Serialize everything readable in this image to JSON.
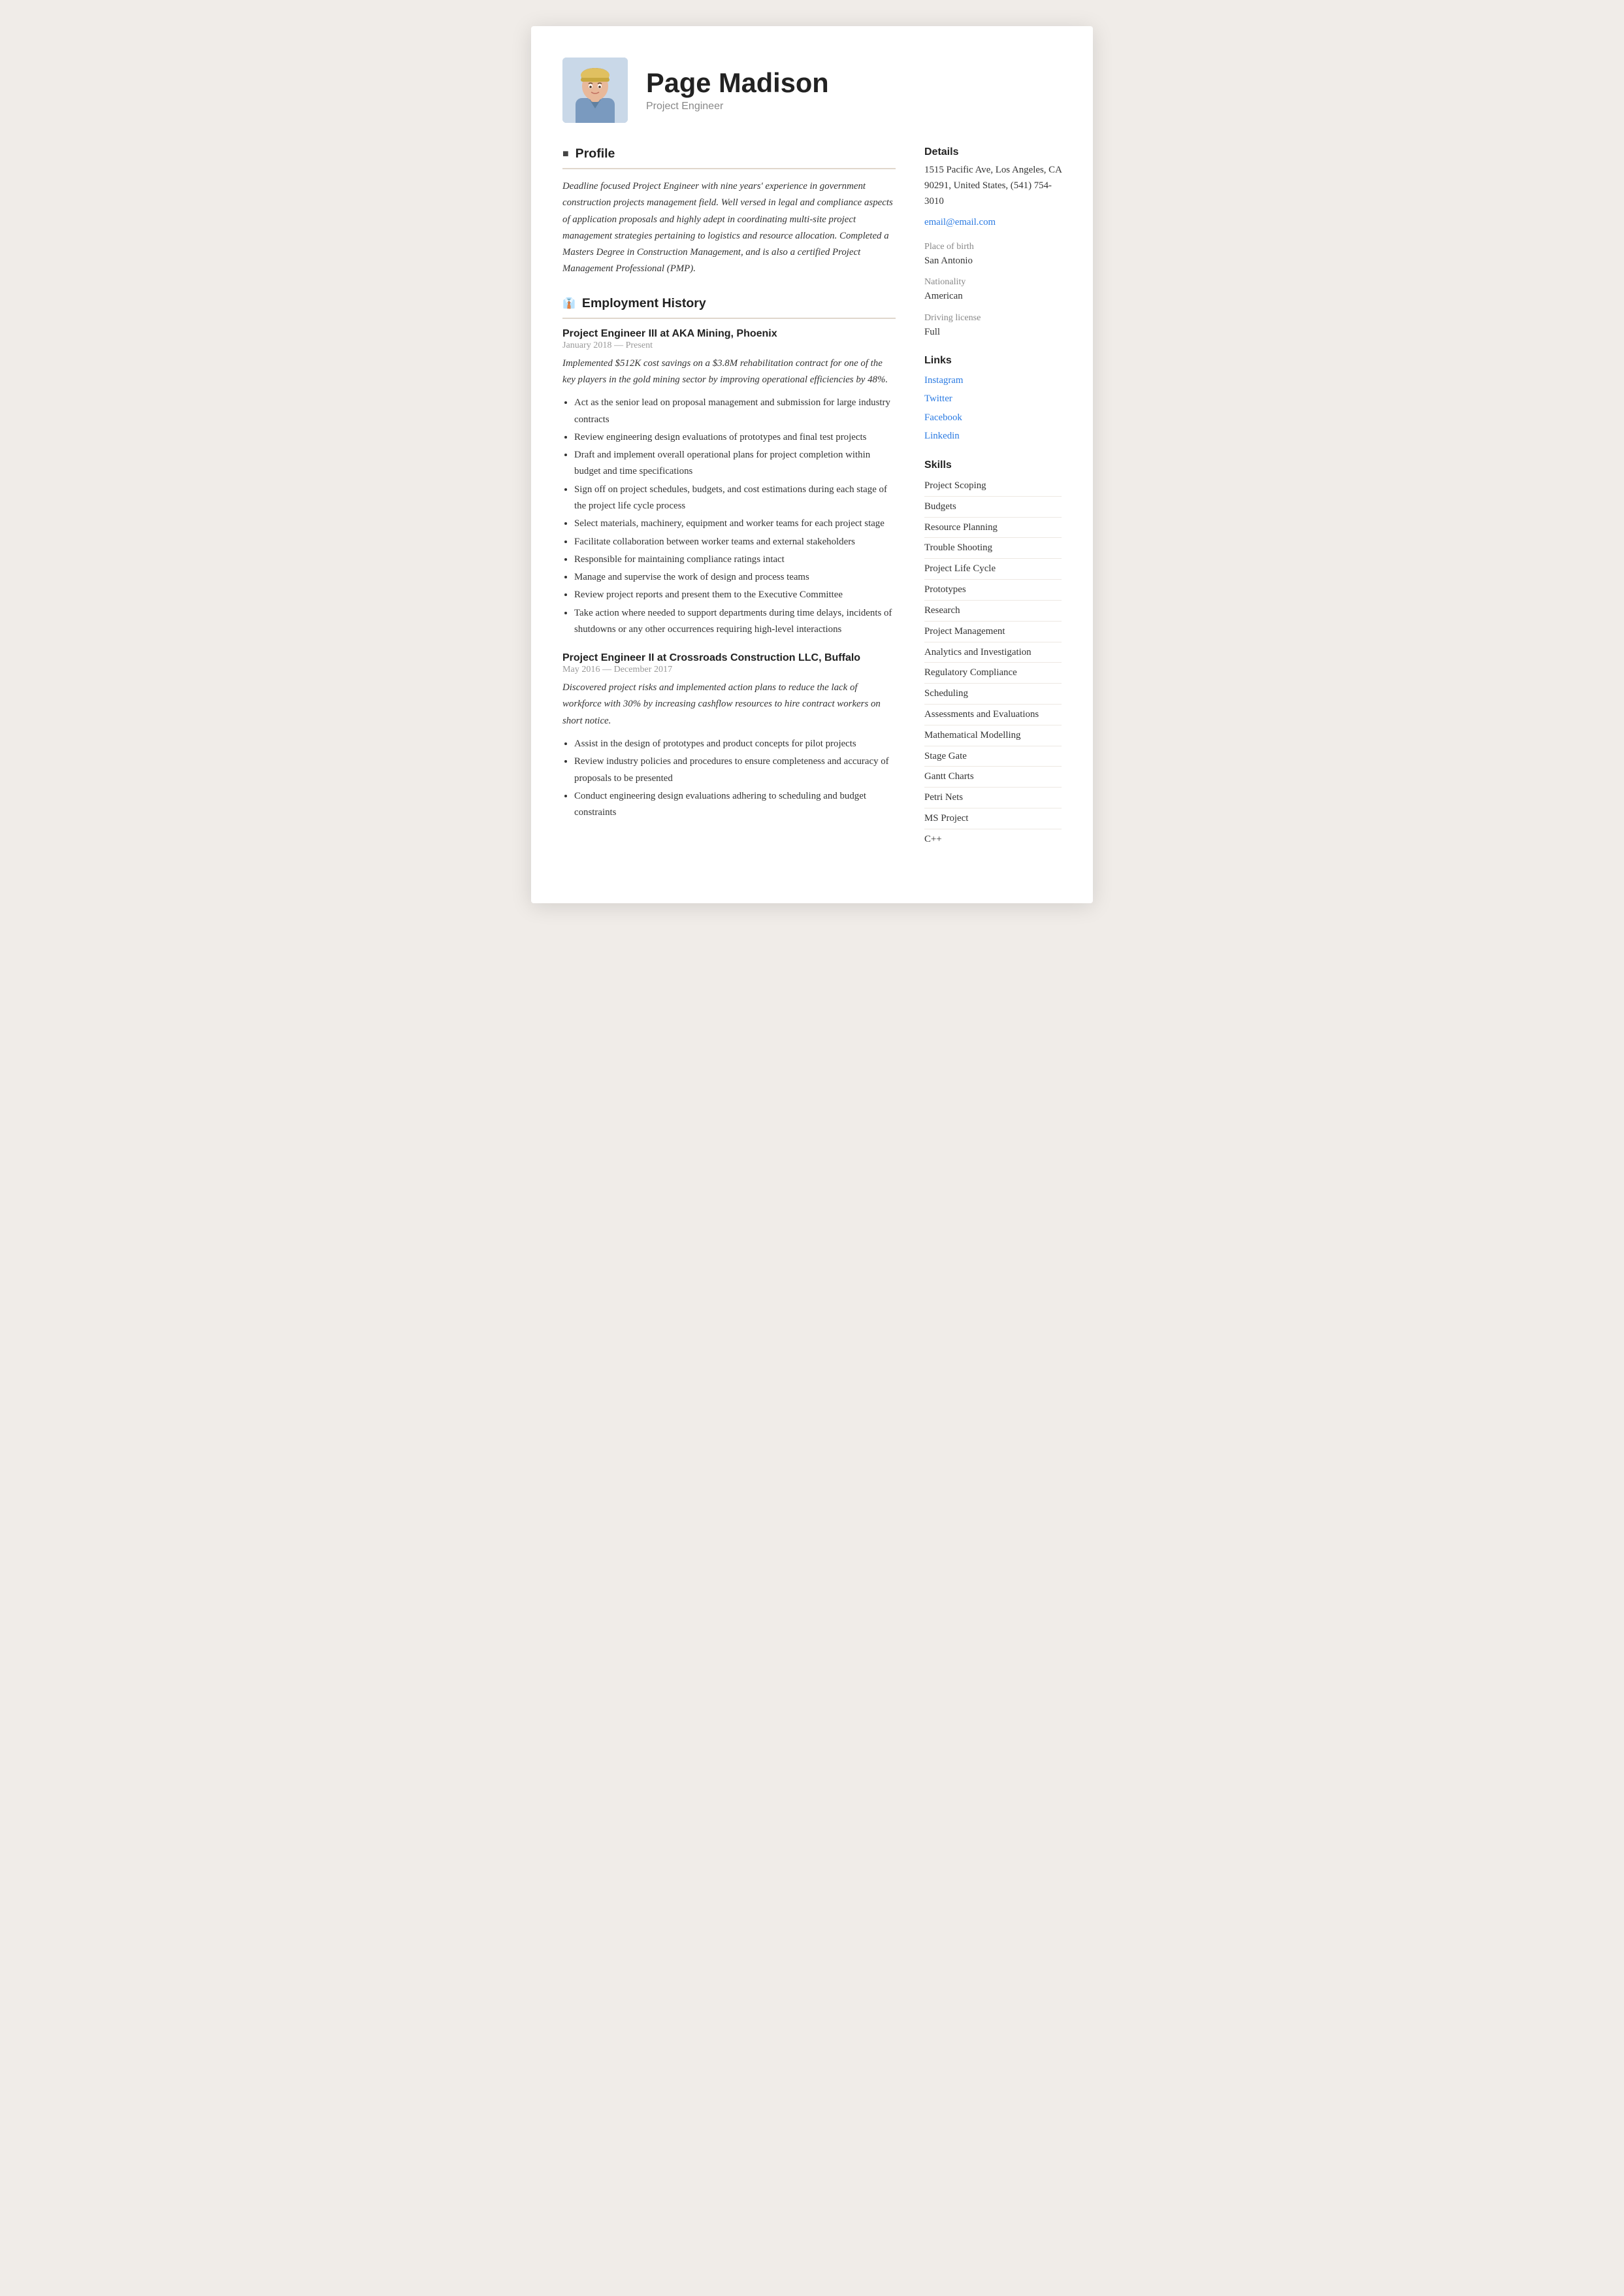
{
  "header": {
    "name": "Page Madison",
    "title": "Project Engineer"
  },
  "profile": {
    "section_title": "Profile",
    "text": "Deadline focused Project Engineer with nine years' experience in government construction projects management field. Well versed in legal and compliance aspects of application proposals and highly adept in coordinating multi-site project management strategies pertaining to logistics and resource allocation. Completed a Masters Degree in Construction Management, and is also a certified Project Management Professional (PMP)."
  },
  "employment": {
    "section_title": "Employment History",
    "jobs": [
      {
        "title": "Project Engineer III at  AKA Mining, Phoenix",
        "date": "January 2018 — Present",
        "desc": "Implemented $512K cost savings on a $3.8M rehabilitation contract for one of the key players in the gold mining sector by improving operational efficiencies by 48%.",
        "bullets": [
          "Act as the senior lead on proposal management and submission for large industry contracts",
          "Review engineering design evaluations of prototypes and final test projects",
          "Draft and implement overall operational plans for project completion within budget and time specifications",
          "Sign off on project schedules, budgets, and cost estimations during each stage of the project life cycle process",
          "Select materials, machinery, equipment and worker teams for each project stage",
          "Facilitate collaboration between worker teams and external stakeholders",
          "Responsible for maintaining compliance ratings intact",
          "Manage and supervise the work of design and process teams",
          "Review project reports and present them to the Executive Committee",
          "Take action where needed to support departments during time delays, incidents of shutdowns or any other occurrences requiring high-level interactions"
        ]
      },
      {
        "title": "Project Engineer II at  Crossroads Construction LLC, Buffalo",
        "date": "May 2016 — December 2017",
        "desc": "Discovered project risks and implemented action plans to reduce the lack of workforce with 30% by increasing cashflow resources to hire contract workers on short notice.",
        "bullets": [
          "Assist in the design of prototypes and product concepts for pilot projects",
          "Review industry policies and procedures to ensure completeness and accuracy of proposals to be presented",
          "Conduct engineering design evaluations adhering to scheduling and budget constraints"
        ]
      }
    ]
  },
  "details": {
    "section_title": "Details",
    "address": "1515 Pacific Ave, Los Angeles, CA 90291, United States, (541) 754-3010",
    "email": "email@email.com",
    "place_of_birth_label": "Place of birth",
    "place_of_birth": "San Antonio",
    "nationality_label": "Nationality",
    "nationality": "American",
    "driving_license_label": "Driving license",
    "driving_license": "Full"
  },
  "links": {
    "section_title": "Links",
    "items": [
      {
        "label": "Instagram",
        "url": "#"
      },
      {
        "label": "Twitter",
        "url": "#"
      },
      {
        "label": "Facebook",
        "url": "#"
      },
      {
        "label": "Linkedin",
        "url": "#"
      }
    ]
  },
  "skills": {
    "section_title": "Skills",
    "items": [
      "Project Scoping",
      "Budgets",
      "Resource Planning",
      "Trouble Shooting",
      "Project Life Cycle",
      "Prototypes",
      "Research",
      "Project Management",
      "Analytics and Investigation",
      "Regulatory Compliance",
      "Scheduling",
      "Assessments and Evaluations",
      "Mathematical Modelling",
      "Stage Gate",
      "Gantt Charts",
      "Petri Nets",
      "MS Project",
      "C++"
    ]
  }
}
